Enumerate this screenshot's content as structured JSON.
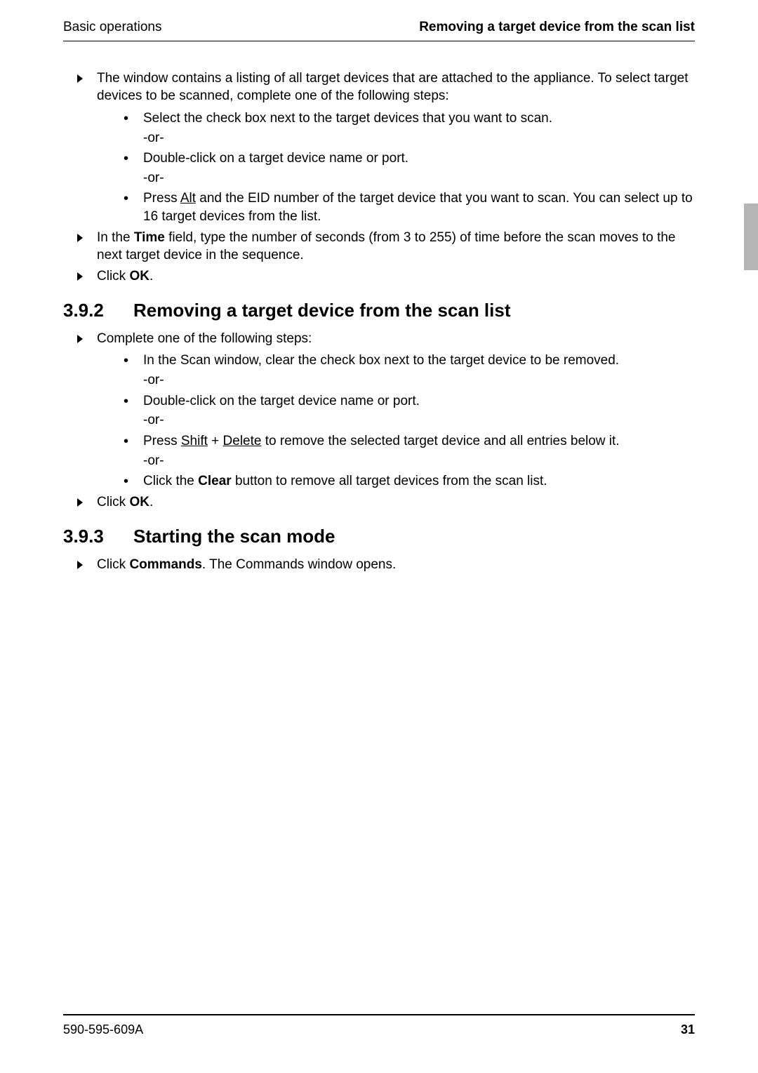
{
  "header": {
    "left": "Basic operations",
    "right": "Removing a target device from the scan list"
  },
  "body": {
    "intro_arrow_1": "The window contains a listing of all target devices that are attached to the appliance. To select target devices to be scanned, complete one of the following steps:",
    "sel_checkbox": "Select the check box next to the target devices that you want to scan.",
    "or1": "-or-",
    "dbl_click_name": "Double-click on a target device name or port.",
    "or2": "-or-",
    "press_alt_pre": "Press ",
    "alt": "Alt",
    "press_alt_post": " and the EID number of the target device that you want to scan. You can select up to 16 target devices from the list.",
    "time_pre": "In the ",
    "time_bold": "Time",
    "time_post": " field, type the number of seconds (from 3 to 255) of time before the scan moves to the next target device in the sequence.",
    "click_ok_pre": "Click ",
    "ok": "OK",
    "click_ok_post": "."
  },
  "sec392": {
    "num": "3.9.2",
    "title": "Removing a target device from the scan list",
    "complete": "Complete one of the following steps:",
    "scan_clear": "In the Scan window, clear the check box next to the target device to be removed.",
    "or1": "-or-",
    "dbl_click": "Double-click on the target device name or port.",
    "or2": "-or-",
    "press_pre": "Press ",
    "shift": "Shift",
    "plus": " + ",
    "delete": "Delete",
    "press_post": " to remove the selected target device and all entries below it.",
    "or3": "-or-",
    "clear_pre": "Click the ",
    "clear_bold": "Clear",
    "clear_post": " button to remove all target devices from the scan list.",
    "click_ok_pre": "Click ",
    "ok": "OK",
    "click_ok_post": "."
  },
  "sec393": {
    "num": "3.9.3",
    "title": "Starting the scan mode",
    "click_pre": "Click ",
    "commands": "Commands",
    "click_post": ". The Commands window opens."
  },
  "footer": {
    "left": "590-595-609A",
    "right": "31"
  }
}
